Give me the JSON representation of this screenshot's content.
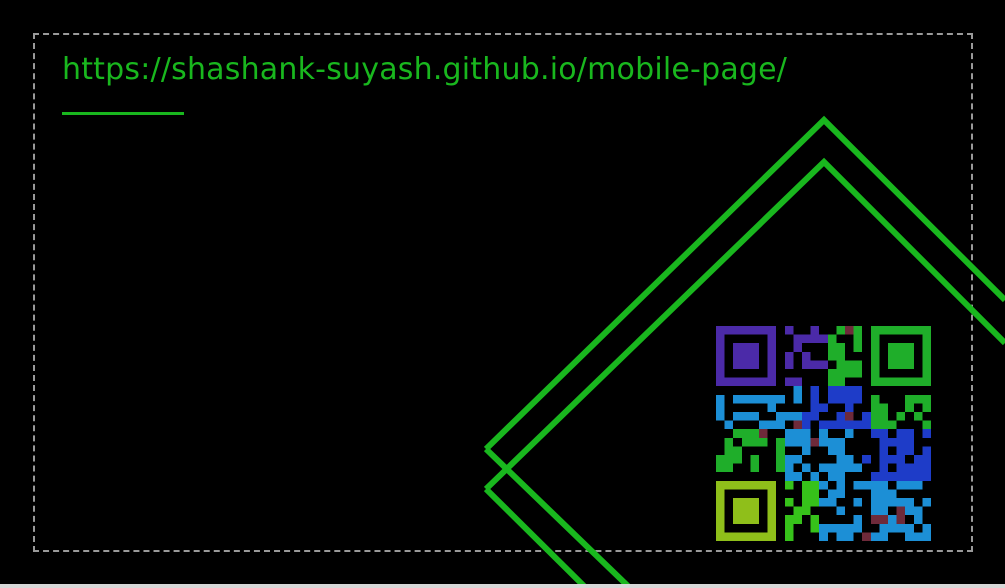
{
  "card": {
    "url_text": "https://shashank-suyash.github.io/mobile-page/"
  },
  "colors": {
    "background": "#000000",
    "accent_green": "#19b71e",
    "border_gray": "#9a9a9a",
    "qr_palette": [
      "#1e3cc8",
      "#4b2aa8",
      "#1c8fd6",
      "#1fae2a",
      "#36c21a",
      "#8fbf1a",
      "#6e2a3a"
    ]
  },
  "icons": {
    "qr": "qr-code-icon"
  }
}
